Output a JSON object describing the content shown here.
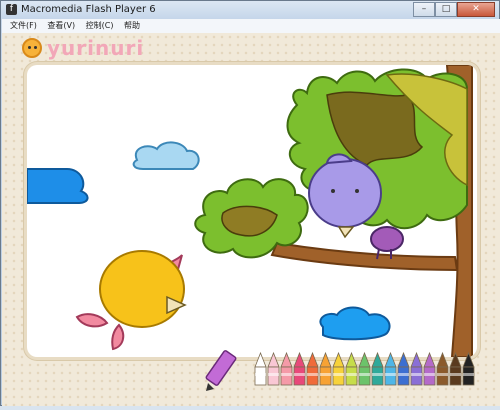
{
  "window": {
    "title": "Macromedia Flash Player 6",
    "minimize_glyph": "–",
    "maximize_glyph": "□",
    "close_glyph": "✕"
  },
  "menu": {
    "items": [
      "文件(F)",
      "查看(V)",
      "控制(C)",
      "帮助"
    ]
  },
  "logo": {
    "text": "yurinuri"
  },
  "palette": {
    "colors": [
      "#ffffff",
      "#f9c7d4",
      "#f59aa8",
      "#e8497a",
      "#f06b3a",
      "#f7a234",
      "#f7d23a",
      "#c6dd4a",
      "#6cc36a",
      "#2fa99a",
      "#4fb6e7",
      "#3c6fd1",
      "#8a6fd6",
      "#b46ac9",
      "#8b5a2b",
      "#5a3a1e",
      "#222222"
    ]
  },
  "icons": [
    "app-icon",
    "pencil-icon",
    "crayon-icon"
  ]
}
